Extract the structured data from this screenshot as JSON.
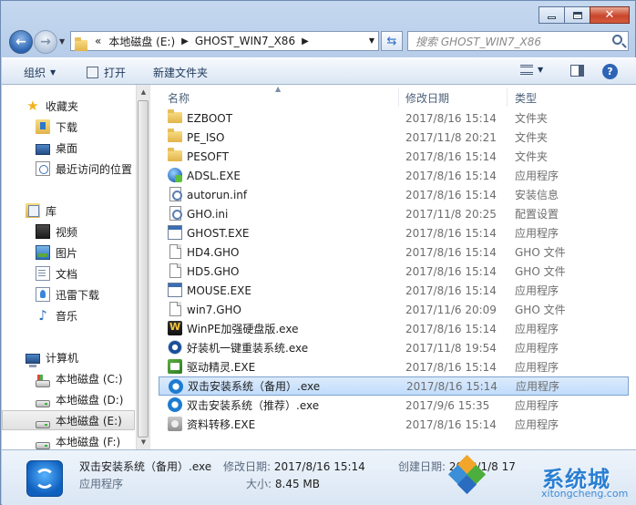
{
  "address": {
    "overflow": "«",
    "crumbs": [
      "本地磁盘 (E:)",
      "GHOST_WIN7_X86"
    ]
  },
  "search": {
    "placeholder": "搜索 GHOST_WIN7_X86"
  },
  "toolbar": {
    "organize": "组织",
    "open": "打开",
    "new_folder": "新建文件夹"
  },
  "sidebar": {
    "favorites": {
      "label": "收藏夹",
      "items": [
        "下载",
        "桌面",
        "最近访问的位置"
      ]
    },
    "libraries": {
      "label": "库",
      "items": [
        "视频",
        "图片",
        "文档",
        "迅雷下载",
        "音乐"
      ]
    },
    "computer": {
      "label": "计算机",
      "items": [
        "本地磁盘 (C:)",
        "本地磁盘 (D:)",
        "本地磁盘 (E:)",
        "本地磁盘 (F:)"
      ]
    }
  },
  "columns": {
    "name": "名称",
    "date": "修改日期",
    "type": "类型"
  },
  "files": [
    {
      "name": "EZBOOT",
      "date": "2017/8/16 15:14",
      "type": "文件夹",
      "icon": "folder-icon"
    },
    {
      "name": "PE_ISO",
      "date": "2017/11/8 20:21",
      "type": "文件夹",
      "icon": "folder-icon"
    },
    {
      "name": "PESOFT",
      "date": "2017/8/16 15:14",
      "type": "文件夹",
      "icon": "folder-icon"
    },
    {
      "name": "ADSL.EXE",
      "date": "2017/8/16 15:14",
      "type": "应用程序",
      "icon": "globe-icon"
    },
    {
      "name": "autorun.inf",
      "date": "2017/8/16 15:14",
      "type": "安装信息",
      "icon": "config-file-icon"
    },
    {
      "name": "GHO.ini",
      "date": "2017/11/8 20:25",
      "type": "配置设置",
      "icon": "config-file-icon"
    },
    {
      "name": "GHOST.EXE",
      "date": "2017/8/16 15:14",
      "type": "应用程序",
      "icon": "exe-icon"
    },
    {
      "name": "HD4.GHO",
      "date": "2017/8/16 15:14",
      "type": "GHO 文件",
      "icon": "file-icon"
    },
    {
      "name": "HD5.GHO",
      "date": "2017/8/16 15:14",
      "type": "GHO 文件",
      "icon": "file-icon"
    },
    {
      "name": "MOUSE.EXE",
      "date": "2017/8/16 15:14",
      "type": "应用程序",
      "icon": "exe-icon"
    },
    {
      "name": "win7.GHO",
      "date": "2017/11/6 20:09",
      "type": "GHO 文件",
      "icon": "file-icon"
    },
    {
      "name": "WinPE加强硬盘版.exe",
      "date": "2017/8/16 15:14",
      "type": "应用程序",
      "icon": "winpe-icon"
    },
    {
      "name": "好装机一键重装系统.exe",
      "date": "2017/11/8 19:54",
      "type": "应用程序",
      "icon": "disc-icon"
    },
    {
      "name": "驱动精灵.EXE",
      "date": "2017/8/16 15:14",
      "type": "应用程序",
      "icon": "driver-icon"
    },
    {
      "name": "双击安装系统（备用）.exe",
      "date": "2017/8/16 15:14",
      "type": "应用程序",
      "icon": "sync-icon",
      "selected": true
    },
    {
      "name": "双击安装系统（推荐）.exe",
      "date": "2017/9/6 15:35",
      "type": "应用程序",
      "icon": "sync-icon"
    },
    {
      "name": "资料转移.EXE",
      "date": "2017/8/16 15:14",
      "type": "应用程序",
      "icon": "transfer-icon"
    }
  ],
  "details": {
    "name": "双击安装系统（备用）.exe",
    "kind": "应用程序",
    "modified_label": "修改日期:",
    "modified": "2017/8/16 15:14",
    "size_label": "大小:",
    "size": "8.45 MB",
    "created_label": "创建日期:",
    "created": "2018/1/8 17"
  },
  "watermark": {
    "brand": "系统城",
    "url": "xitongcheng.com"
  }
}
